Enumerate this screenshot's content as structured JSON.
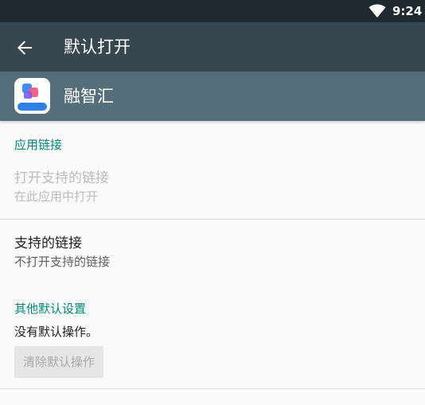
{
  "status_bar": {
    "time": "9:24",
    "wifi_icon": "wifi-full-icon"
  },
  "toolbar": {
    "back_icon": "arrow-back-icon",
    "title": "默认打开"
  },
  "app": {
    "name": "融智汇",
    "icon_label": "融智汇"
  },
  "app_links": {
    "section_title": "应用链接",
    "open_supported": {
      "title": "打开支持的链接",
      "summary": "在此应用中打开"
    },
    "supported_links": {
      "title": "支持的链接",
      "summary": "不打开支持的链接"
    }
  },
  "other_defaults": {
    "section_title": "其他默认设置",
    "summary": "没有默认操作。",
    "clear_button_label": "清除默认操作"
  },
  "colors": {
    "status_bar": "#1f2a30",
    "toolbar": "#37474f",
    "app_header": "#546e7a",
    "accent": "#00897b"
  }
}
